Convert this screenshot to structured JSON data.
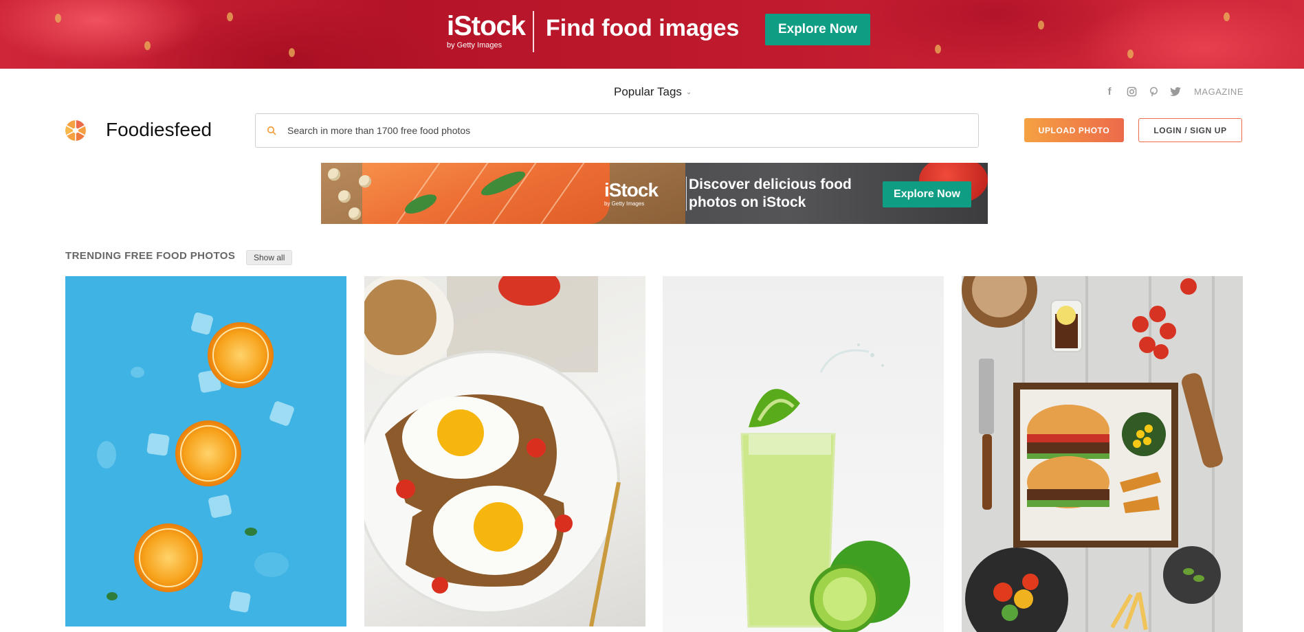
{
  "top_banner": {
    "logo_word": "iStock",
    "logo_sub": "by Getty Images",
    "headline": "Find food images",
    "cta": "Explore Now"
  },
  "nav": {
    "popular_tags": "Popular Tags",
    "socials": [
      "facebook-icon",
      "instagram-icon",
      "pinterest-icon",
      "twitter-icon"
    ],
    "magazine": "MAGAZINE"
  },
  "header": {
    "site_name": "Foodiesfeed",
    "search_placeholder": "Search in more than 1700 free food photos",
    "upload": "UPLOAD PHOTO",
    "login": "LOGIN / SIGN UP"
  },
  "ad_banner": {
    "logo_word": "iStock",
    "logo_sub": "by Getty Images",
    "headline_line1": "Discover delicious food",
    "headline_line2": "photos on iStock",
    "cta": "Explore Now"
  },
  "trending": {
    "title": "TRENDING FREE FOOD PHOTOS",
    "show_all": "Show all",
    "photos": [
      "oranges-on-blue",
      "fried-eggs-toast",
      "lime-juice-glass",
      "burger-platter"
    ]
  },
  "colors": {
    "accent_orange": "#f5a142",
    "accent_red": "#ec6a4a",
    "istock_green": "#0f9d84"
  }
}
